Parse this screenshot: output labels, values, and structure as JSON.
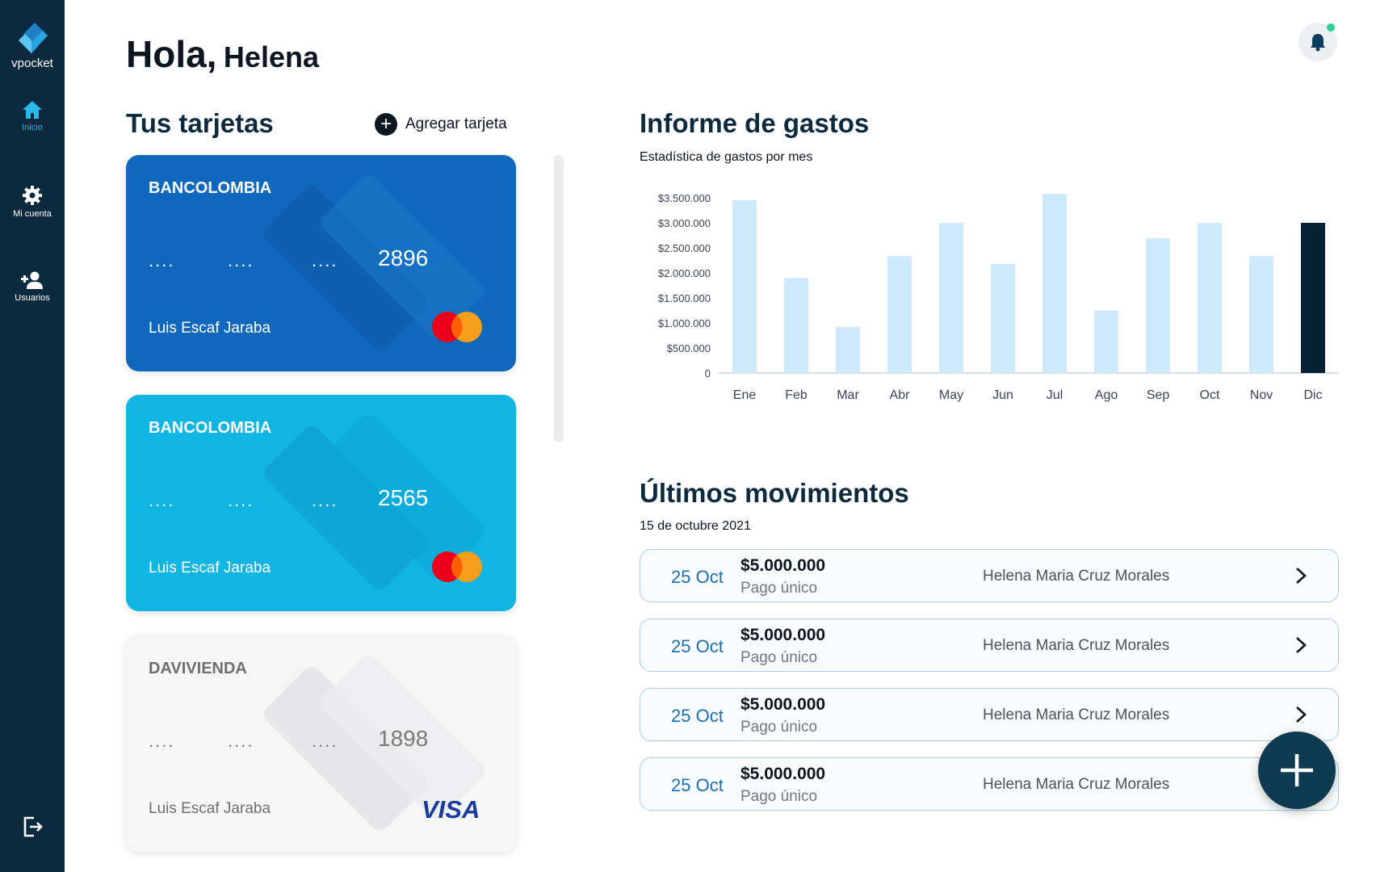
{
  "app": {
    "logo_text": "vpocket"
  },
  "sidebar": {
    "items": [
      {
        "label": "Inicio",
        "icon": "home-icon",
        "active": true
      },
      {
        "label": "Mi cuenta",
        "icon": "gear-icon",
        "active": false
      },
      {
        "label": "Usuarios",
        "icon": "add-user-icon",
        "active": false
      }
    ],
    "logout_icon": "logout-icon"
  },
  "header": {
    "greeting": "Hola,",
    "user_name": "Helena"
  },
  "cards_section": {
    "title": "Tus tarjetas",
    "add_label": "Agregar tarjeta",
    "cards": [
      {
        "bank": "BANCOLOMBIA",
        "masked": "....",
        "last4": "2896",
        "holder": "Luis Escaf Jaraba",
        "network": "mastercard",
        "color": "#1068bd"
      },
      {
        "bank": "BANCOLOMBIA",
        "masked": "....",
        "last4": "2565",
        "holder": "Luis Escaf Jaraba",
        "network": "mastercard",
        "color": "#12b5e2"
      },
      {
        "bank": "DAVIVIENDA",
        "masked": "....",
        "last4": "1898",
        "holder": "Luis Escaf Jaraba",
        "network": "VISA",
        "color": "#f6f6f7"
      }
    ]
  },
  "report": {
    "title": "Informe de gastos",
    "subtitle": "Estadística de gastos por mes"
  },
  "chart_data": {
    "type": "bar",
    "title": "Informe de gastos",
    "subtitle": "Estadística de gastos por mes",
    "categories": [
      "Ene",
      "Feb",
      "Mar",
      "Abr",
      "May",
      "Jun",
      "Jul",
      "Ago",
      "Sep",
      "Oct",
      "Nov",
      "Dic"
    ],
    "values": [
      3450000,
      1900000,
      920000,
      2340000,
      3000000,
      2180000,
      3680000,
      1250000,
      2690000,
      3000000,
      2340000,
      3000000
    ],
    "highlight_index": 11,
    "ylim": [
      0,
      3500000
    ],
    "yticks": [
      0,
      500000,
      1000000,
      1500000,
      2000000,
      2500000,
      3000000,
      3500000
    ],
    "ytick_labels": [
      "0",
      "$500.000",
      "$1.000.000",
      "$1.500.000",
      "$2.000.000",
      "$2.500.000",
      "$3.000.000",
      "$3.500.000"
    ],
    "bar_color": "#cde9fb",
    "highlight_color": "#062234",
    "grid": false
  },
  "movements": {
    "title": "Últimos movimientos",
    "date_label": "15 de octubre 2021",
    "items": [
      {
        "date": "25 Oct",
        "amount": "$5.000.000",
        "type": "Pago único",
        "name": "Helena Maria Cruz Morales"
      },
      {
        "date": "25 Oct",
        "amount": "$5.000.000",
        "type": "Pago único",
        "name": "Helena Maria Cruz Morales"
      },
      {
        "date": "25 Oct",
        "amount": "$5.000.000",
        "type": "Pago único",
        "name": "Helena Maria Cruz Morales"
      },
      {
        "date": "25 Oct",
        "amount": "$5.000.000",
        "type": "Pago único",
        "name": "Helena Maria Cruz Morales"
      }
    ]
  },
  "fab": {
    "icon": "plus-icon"
  },
  "notifications": {
    "icon": "bell-icon",
    "status_color": "#2bd196"
  }
}
